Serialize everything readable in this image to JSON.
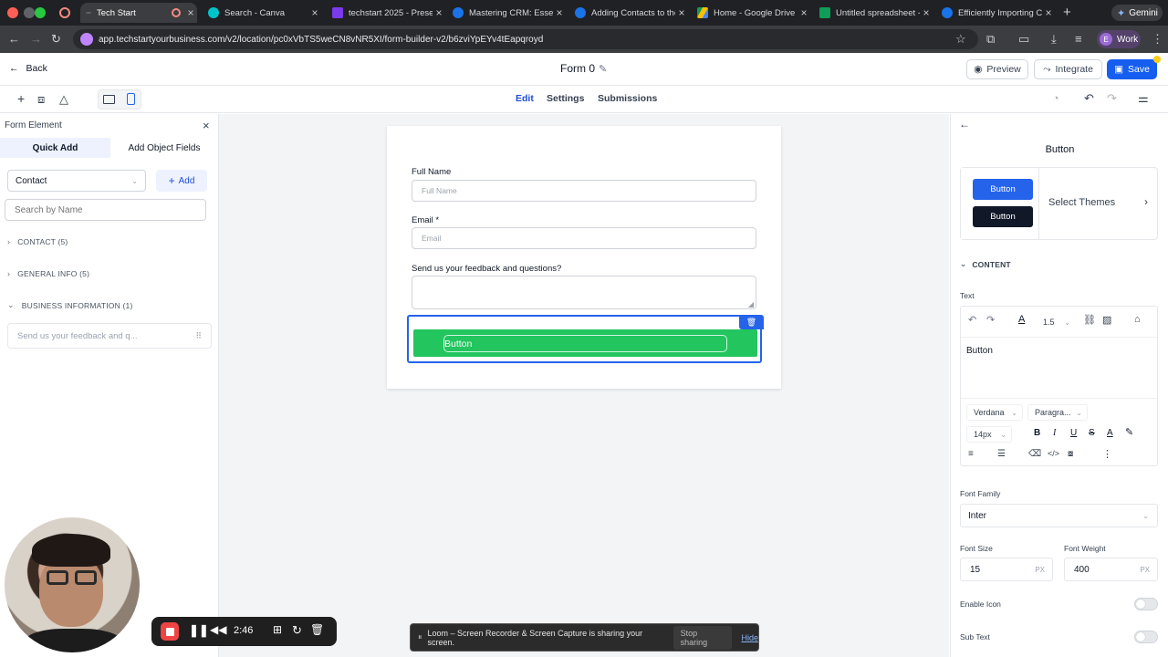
{
  "browser": {
    "tabs": [
      {
        "title": "Tech Start",
        "color": "#5f6368"
      },
      {
        "title": "Search - Canva",
        "color": "#00c4cc"
      },
      {
        "title": "techstart 2025 - Prese",
        "color": "#7c3aed"
      },
      {
        "title": "Mastering CRM: Essen",
        "color": "#1a73e8"
      },
      {
        "title": "Adding Contacts to the",
        "color": "#1a73e8"
      },
      {
        "title": "Home - Google Drive",
        "color": "#fbbc04"
      },
      {
        "title": "Untitled spreadsheet -",
        "color": "#0f9d58"
      },
      {
        "title": "Efficiently Importing C",
        "color": "#1a73e8"
      }
    ],
    "gemini_label": "Gemini",
    "url": "app.techstartyourbusiness.com/v2/location/pc0xVbTS5weCN8vNR5XI/form-builder-v2/b6zviYpEYv4tEapqroyd",
    "profile_label": "Work",
    "profile_initial": "E"
  },
  "appbar": {
    "back_label": "Back",
    "form_title": "Form 0",
    "preview_label": "Preview",
    "integrate_label": "Integrate",
    "save_label": "Save"
  },
  "toolbar": {
    "tabs": [
      "Edit",
      "Settings",
      "Submissions"
    ]
  },
  "left_panel": {
    "title": "Form Element",
    "tabs": [
      "Quick Add",
      "Add Object Fields"
    ],
    "object_select": "Contact",
    "add_label": "Add",
    "search_placeholder": "Search by Name",
    "sections": [
      "CONTACT (5)",
      "GENERAL INFO (5)",
      "BUSINESS INFORMATION (1)"
    ],
    "business_field": "Send us your feedback and q..."
  },
  "form": {
    "fields": [
      {
        "label": "Full Name",
        "placeholder": "Full Name"
      },
      {
        "label": "Email *",
        "placeholder": "Email"
      },
      {
        "label": "Send us your feedback and questions?",
        "placeholder": ""
      }
    ],
    "button_text": "Button",
    "button_color": "#22c55e"
  },
  "right_panel": {
    "title": "Button",
    "theme_buttons": [
      "Button",
      "Button"
    ],
    "select_themes": "Select Themes",
    "content_section": "CONTENT",
    "text_label": "Text",
    "line_height": "1.5",
    "editor_text": "Button",
    "font_select": "Verdana",
    "block_select": "Paragra...",
    "size_select": "14px",
    "font_family_label": "Font Family",
    "font_family_value": "Inter",
    "font_size_label": "Font Size",
    "font_size_value": "15",
    "font_size_unit": "PX",
    "font_weight_label": "Font Weight",
    "font_weight_value": "400",
    "font_weight_unit": "PX",
    "enable_icon_label": "Enable Icon",
    "enable_icon_on": false,
    "sub_text_label": "Sub Text",
    "sub_text_on": false
  },
  "recorder": {
    "time": "2:46"
  },
  "share_bar": {
    "message": "Loom – Screen Recorder & Screen Capture is sharing your screen.",
    "stop_label": "Stop sharing",
    "hide_label": "Hide"
  }
}
